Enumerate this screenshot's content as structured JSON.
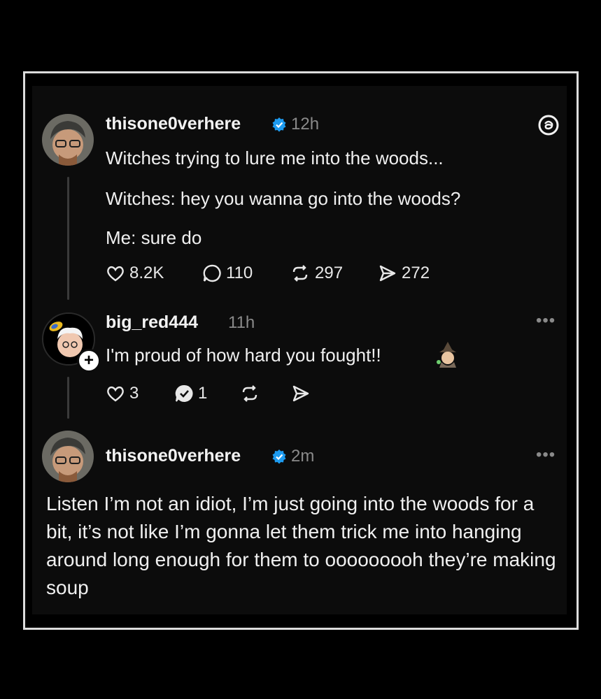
{
  "post1": {
    "username": "thisone0verhere",
    "time": "12h",
    "lines": [
      "Witches trying to lure me into the woods...",
      "Witches: hey you wanna go into the woods?",
      "Me: sure do"
    ],
    "likes": "8.2K",
    "replies": "110",
    "reposts": "297",
    "shares": "272"
  },
  "post2": {
    "username": "big_red444",
    "time": "11h",
    "text": "I'm proud of how hard you fought!!",
    "likes": "3",
    "replies": "1",
    "more": "•••"
  },
  "post3": {
    "username": "thisone0verhere",
    "time": "2m",
    "text": "Listen I’m not an idiot, I’m just going into the woods for a bit, it’s not like I’m gonna let them trick me into hanging around long enough for them to ooooooooh they’re making soup",
    "more": "•••"
  },
  "colors": {
    "verified": "#1d9bf0",
    "background": "#0c0c0c",
    "muted": "#8a8a8a"
  },
  "icons": [
    "threads-logo-icon",
    "verified-icon",
    "heart-icon",
    "comment-icon",
    "repost-icon",
    "share-icon",
    "plus-icon",
    "witch-emoji-icon",
    "more-icon"
  ]
}
